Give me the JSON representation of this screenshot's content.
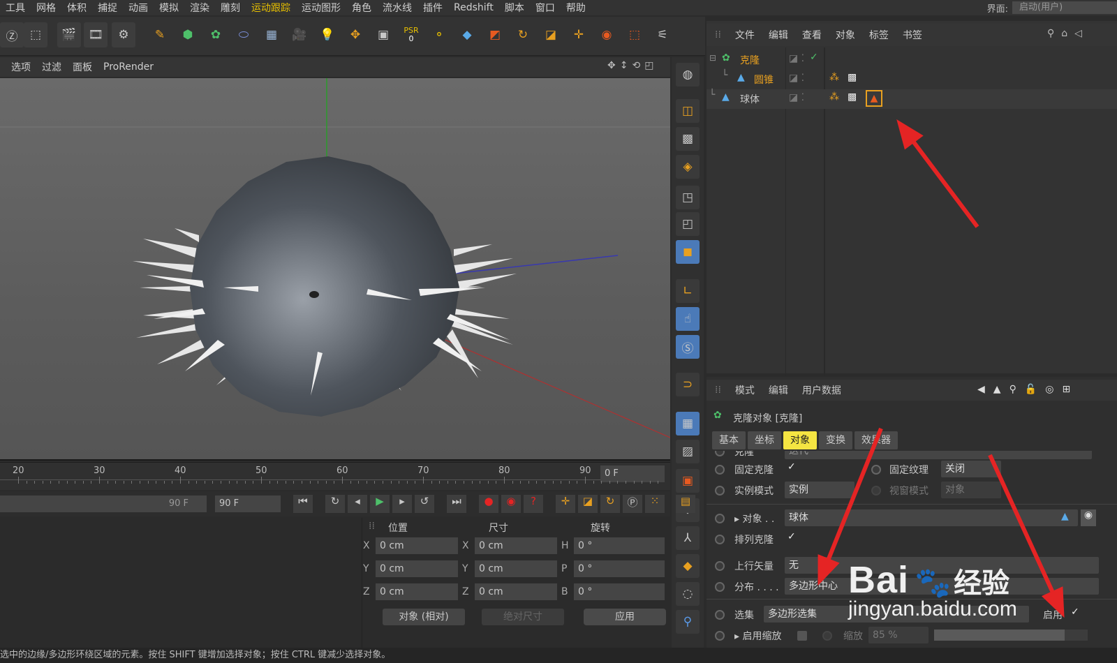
{
  "menu": [
    "工具",
    "网格",
    "体积",
    "捕捉",
    "动画",
    "模拟",
    "渲染",
    "雕刻",
    "运动跟踪",
    "运动图形",
    "角色",
    "流水线",
    "插件",
    "Redshift",
    "脚本",
    "窗口",
    "帮助"
  ],
  "menu_highlight": [
    "运动跟踪"
  ],
  "interface_label": "界面:",
  "interface_value": "启动(用户)",
  "toolbar_psr": "PSR",
  "toolbar_psr_val": "0",
  "viewport_menu": [
    "选项",
    "过滤",
    "面板",
    "ProRender"
  ],
  "object_menu": [
    "文件",
    "编辑",
    "查看",
    "对象",
    "标签",
    "书签"
  ],
  "objects": [
    {
      "name": "克隆",
      "color": "#e8a020",
      "indent": 0
    },
    {
      "name": "圆锥",
      "color": "#e8a020",
      "indent": 1
    },
    {
      "name": "球体",
      "color": "#cfcfcf",
      "indent": 0
    }
  ],
  "attr_menu": [
    "模式",
    "编辑",
    "用户数据"
  ],
  "attr_title": "克隆对象 [克隆]",
  "tabs": [
    {
      "label": "基本",
      "selected": false
    },
    {
      "label": "坐标",
      "selected": false
    },
    {
      "label": "对象",
      "selected": true
    },
    {
      "label": "变换",
      "selected": false
    },
    {
      "label": "效果器",
      "selected": false
    }
  ],
  "attr_rows": {
    "clone_label": "克隆",
    "clone_value": "迭代",
    "fixed_clone": "固定克隆",
    "fixed_texture": "固定纹理",
    "fixed_texture_value": "关闭",
    "instance_mode": "实例模式",
    "instance_value": "实例",
    "viewport_mode": "视窗模式",
    "viewport_value": "对象",
    "object_label": "对象 . .",
    "object_value": "球体",
    "arrange_clone": "排列克隆",
    "up_vector": "上行矢量",
    "up_vector_value": "无",
    "distribution": "分布 . . . .",
    "distribution_value": "多边形中心",
    "selection": "选集",
    "selection_value": "多边形选集",
    "enable": "启用",
    "enable_scale": "启用缩放",
    "scale": "缩放",
    "scale_value": "85 %"
  },
  "timeline_ticks": [
    "20",
    "30",
    "40",
    "50",
    "60",
    "70",
    "80",
    "90"
  ],
  "current_frame": "0 F",
  "end_frame_a": "90 F",
  "end_frame_b": "90 F",
  "coord_headers": [
    "位置",
    "尺寸",
    "旋转"
  ],
  "coords": [
    {
      "axis": "X",
      "pos": "0 cm",
      "size_axis": "X",
      "size": "0 cm",
      "rot_axis": "H",
      "rot": "0 °"
    },
    {
      "axis": "Y",
      "pos": "0 cm",
      "size_axis": "Y",
      "size": "0 cm",
      "rot_axis": "P",
      "rot": "0 °"
    },
    {
      "axis": "Z",
      "pos": "0 cm",
      "size_axis": "Z",
      "size": "0 cm",
      "rot_axis": "B",
      "rot": "0 °"
    }
  ],
  "coord_mode": "对象 (相对)",
  "size_mode": "绝对尺寸",
  "apply": "应用",
  "status": "选中的边缘/多边形环绕区域的元素。按住 SHIFT 键增加选择对象；按住 CTRL 键减少选择对象。",
  "watermark_a": "Bai",
  "watermark_b": "经验",
  "watermark_url": "jingyan.baidu.com",
  "accent": "#f5e542",
  "arrow_color": "#e52424"
}
